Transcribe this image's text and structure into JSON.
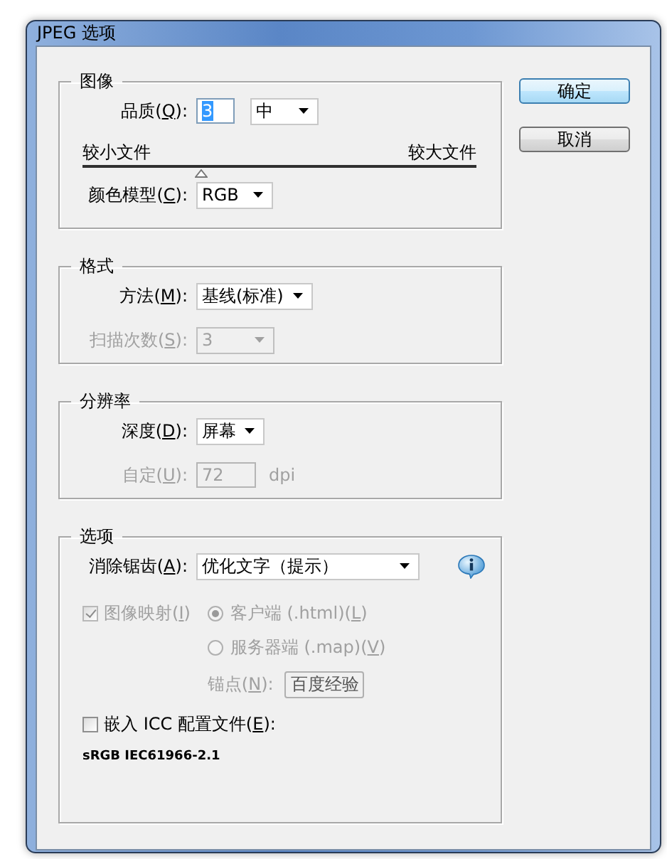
{
  "window": {
    "title": "JPEG 选项"
  },
  "buttons": [
    {
      "label": "确定",
      "default": true
    },
    {
      "label": "取消",
      "default": false
    }
  ],
  "image": {
    "legend": "图像",
    "quality": {
      "label": [
        "品质(",
        "Q",
        "):"
      ],
      "value": "3",
      "preset": "中"
    },
    "slider": {
      "min_label": "较小文件",
      "max_label": "较大文件",
      "level": 0.3
    },
    "color_model": {
      "label": [
        "颜色模型(",
        "C",
        "):"
      ],
      "value": "RGB"
    }
  },
  "format": {
    "legend": "格式",
    "method": {
      "label": [
        "方法(",
        "M",
        "):"
      ],
      "value": "基线(标准)",
      "disabled": false
    },
    "scans": {
      "label": [
        "扫描次数(",
        "S",
        "):"
      ],
      "value": "3",
      "disabled": true
    }
  },
  "resolution": {
    "legend": "分辨率",
    "depth": {
      "label": [
        "深度(",
        "D",
        "):"
      ],
      "value": "屏幕",
      "disabled": false
    },
    "custom": {
      "label": [
        "自定(",
        "U",
        "):"
      ],
      "value": "72",
      "unit": "dpi",
      "disabled": true
    }
  },
  "options": {
    "legend": "选项",
    "antialias": {
      "label": [
        "消除锯齿(",
        "A",
        "):"
      ],
      "value": "优化文字（提示）"
    },
    "image_map": {
      "label": [
        "图像映射(",
        "I",
        ")"
      ],
      "checked": true,
      "disabled": true
    },
    "map_types": [
      {
        "label": [
          "客户端 (.html)(",
          "L",
          ")"
        ],
        "selected": true,
        "disabled": true
      },
      {
        "label": [
          "服务器端 (.map)(",
          "V",
          ")"
        ],
        "selected": false,
        "disabled": true
      }
    ],
    "anchor": {
      "label": [
        "锚点(",
        "N",
        "):"
      ],
      "value": "百度经验",
      "disabled": true
    },
    "embed_icc": {
      "label": [
        "嵌入 ICC 配置文件(",
        "E",
        "):"
      ],
      "checked": false,
      "disabled": false
    },
    "profile": "sRGB IEC61966-2.1"
  }
}
